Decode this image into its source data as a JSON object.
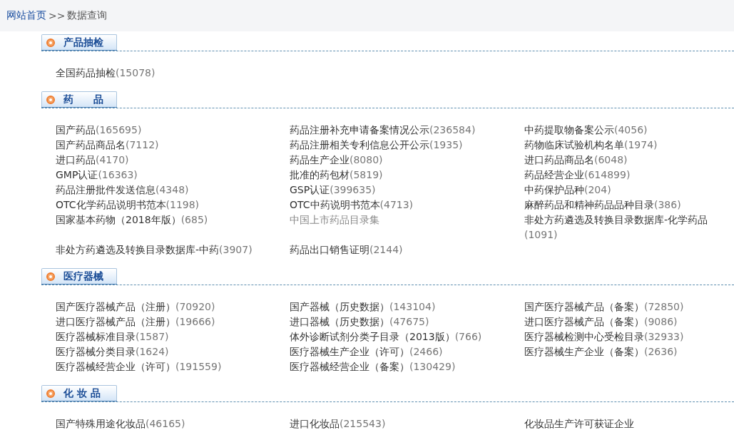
{
  "breadcrumb": {
    "home": "网站首页",
    "separator": ">>",
    "current": "数据查询"
  },
  "sections": [
    {
      "title": "产品抽检",
      "items": [
        {
          "name": "全国药品抽检",
          "count": "(15078)",
          "dimmed": false
        }
      ]
    },
    {
      "title": "药　　品",
      "items": [
        {
          "name": "国产药品",
          "count": "(165695)",
          "dimmed": false
        },
        {
          "name": "药品注册补充申请备案情况公示",
          "count": "(236584)",
          "dimmed": false
        },
        {
          "name": "中药提取物备案公示",
          "count": "(4056)",
          "dimmed": false
        },
        {
          "name": "国产药品商品名",
          "count": "(7112)",
          "dimmed": false
        },
        {
          "name": "药品注册相关专利信息公开公示",
          "count": "(1935)",
          "dimmed": false
        },
        {
          "name": "药物临床试验机构名单",
          "count": "(1974)",
          "dimmed": false
        },
        {
          "name": "进口药品",
          "count": "(4170)",
          "dimmed": false
        },
        {
          "name": "药品生产企业",
          "count": "(8080)",
          "dimmed": false
        },
        {
          "name": "进口药品商品名",
          "count": "(6048)",
          "dimmed": false
        },
        {
          "name": "GMP认证",
          "count": "(16363)",
          "dimmed": false
        },
        {
          "name": "批准的药包材",
          "count": "(5819)",
          "dimmed": false
        },
        {
          "name": "药品经营企业",
          "count": "(614899)",
          "dimmed": false
        },
        {
          "name": "药品注册批件发送信息",
          "count": "(4348)",
          "dimmed": false
        },
        {
          "name": "GSP认证",
          "count": "(399635)",
          "dimmed": false
        },
        {
          "name": "中药保护品种",
          "count": "(204)",
          "dimmed": false
        },
        {
          "name": "OTC化学药品说明书范本",
          "count": "(1198)",
          "dimmed": false
        },
        {
          "name": "OTC中药说明书范本",
          "count": "(4713)",
          "dimmed": false
        },
        {
          "name": "麻醉药品和精神药品品种目录",
          "count": "(386)",
          "dimmed": false
        },
        {
          "name": "国家基本药物（2018年版）",
          "count": "(685)",
          "dimmed": false
        },
        {
          "name": "中国上市药品目录集",
          "dimmed": true
        },
        {
          "name": "非处方药遴选及转换目录数据库-化学药品",
          "count": "(1091)",
          "dimmed": false
        },
        {
          "name": "非处方药遴选及转换目录数据库-中药",
          "count": "(3907)",
          "dimmed": false
        },
        {
          "name": "药品出口销售证明",
          "count": "(2144)",
          "dimmed": false
        }
      ]
    },
    {
      "title": "医疗器械",
      "items": [
        {
          "name": "国产医疗器械产品（注册）",
          "count": "(70920)",
          "dimmed": false
        },
        {
          "name": "国产器械（历史数据）",
          "count": "(143104)",
          "dimmed": false
        },
        {
          "name": "国产医疗器械产品（备案）",
          "count": "(72850)",
          "dimmed": false
        },
        {
          "name": "进口医疗器械产品（注册）",
          "count": "(19666)",
          "dimmed": false
        },
        {
          "name": "进口器械（历史数据）",
          "count": "(47675)",
          "dimmed": false
        },
        {
          "name": "进口医疗器械产品（备案）",
          "count": "(9086)",
          "dimmed": false
        },
        {
          "name": "医疗器械标准目录",
          "count": "(1587)",
          "dimmed": false
        },
        {
          "name": "体外诊断试剂分类子目录（2013版）",
          "count": "(766)",
          "dimmed": false
        },
        {
          "name": "医疗器械检测中心受检目录",
          "count": "(32933)",
          "dimmed": false
        },
        {
          "name": "医疗器械分类目录",
          "count": "(1624)",
          "dimmed": false
        },
        {
          "name": "医疗器械生产企业（许可）",
          "count": "(2466)",
          "dimmed": false
        },
        {
          "name": "医疗器械生产企业（备案）",
          "count": "(2636)",
          "dimmed": false
        },
        {
          "name": "医疗器械经营企业（许可）",
          "count": "(191559)",
          "dimmed": false
        },
        {
          "name": "医疗器械经营企业（备案）",
          "count": "(130429)",
          "dimmed": false
        }
      ]
    },
    {
      "title": "化 妆 品",
      "items": [
        {
          "name": "国产特殊用途化妆品",
          "count": "(46165)",
          "dimmed": false
        },
        {
          "name": "进口化妆品",
          "count": "(215543)",
          "dimmed": false
        },
        {
          "name": "化妆品生产许可获证企业",
          "dimmed": false
        }
      ]
    }
  ]
}
